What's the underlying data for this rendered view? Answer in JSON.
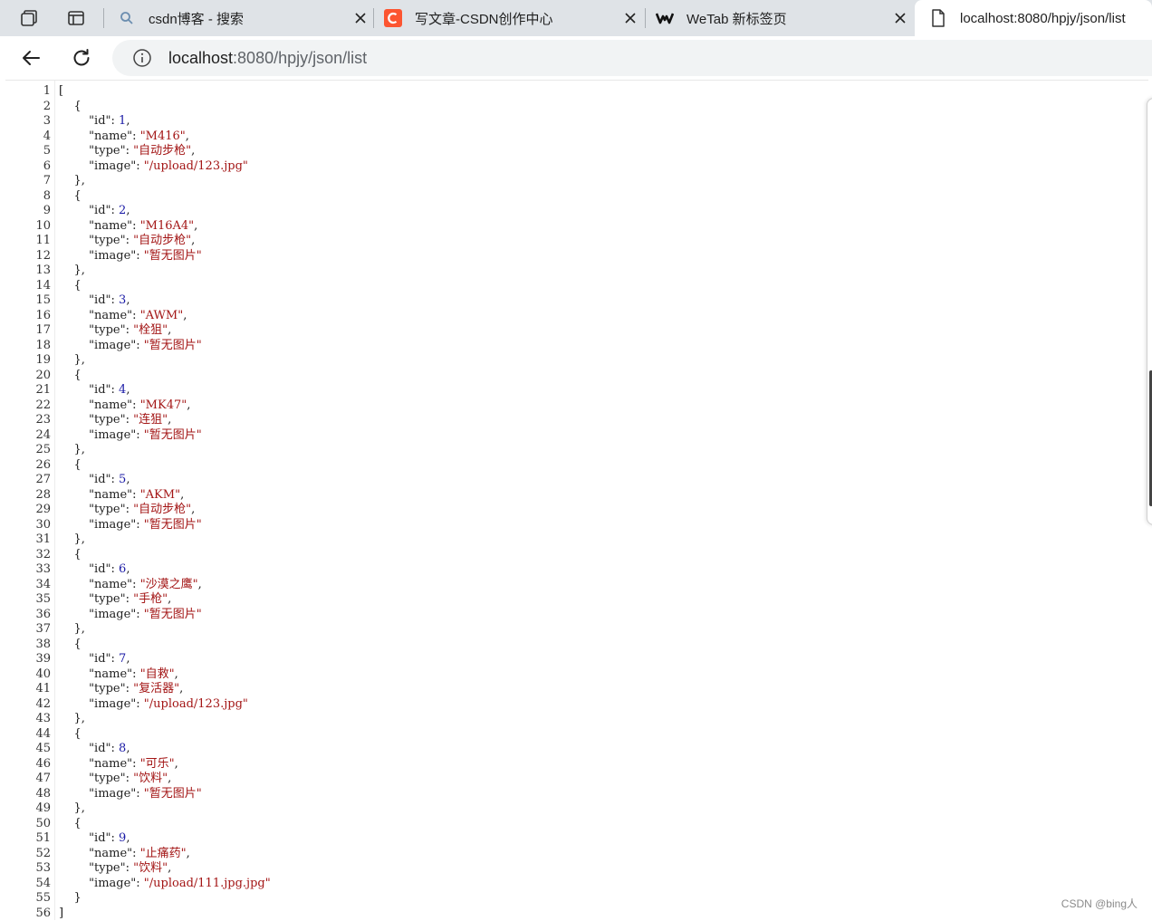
{
  "tabs": [
    {
      "label": "csdn博客 - 搜索",
      "icon": "search-icon"
    },
    {
      "label": "写文章-CSDN创作中心",
      "icon": "csdn-logo-icon"
    },
    {
      "label": "WeTab 新标签页",
      "icon": "wetab-logo-icon"
    },
    {
      "label": "localhost:8080/hpjy/json/list",
      "icon": "page-icon",
      "active": true
    }
  ],
  "address": {
    "host": "localhost",
    "path": ":8080/hpjy/json/list"
  },
  "json_lines": [
    "[",
    "    {",
    "        \"id\": 1,",
    "        \"name\": \"M416\",",
    "        \"type\": \"自动步枪\",",
    "        \"image\": \"/upload/123.jpg\"",
    "    },",
    "    {",
    "        \"id\": 2,",
    "        \"name\": \"M16A4\",",
    "        \"type\": \"自动步枪\",",
    "        \"image\": \"暂无图片\"",
    "    },",
    "    {",
    "        \"id\": 3,",
    "        \"name\": \"AWM\",",
    "        \"type\": \"栓狙\",",
    "        \"image\": \"暂无图片\"",
    "    },",
    "    {",
    "        \"id\": 4,",
    "        \"name\": \"MK47\",",
    "        \"type\": \"连狙\",",
    "        \"image\": \"暂无图片\"",
    "    },",
    "    {",
    "        \"id\": 5,",
    "        \"name\": \"AKM\",",
    "        \"type\": \"自动步枪\",",
    "        \"image\": \"暂无图片\"",
    "    },",
    "    {",
    "        \"id\": 6,",
    "        \"name\": \"沙漠之鹰\",",
    "        \"type\": \"手枪\",",
    "        \"image\": \"暂无图片\"",
    "    },",
    "    {",
    "        \"id\": 7,",
    "        \"name\": \"自救\",",
    "        \"type\": \"复活器\",",
    "        \"image\": \"/upload/123.jpg\"",
    "    },",
    "    {",
    "        \"id\": 8,",
    "        \"name\": \"可乐\",",
    "        \"type\": \"饮料\",",
    "        \"image\": \"暂无图片\"",
    "    },",
    "    {",
    "        \"id\": 9,",
    "        \"name\": \"止痛药\",",
    "        \"type\": \"饮料\",",
    "        \"image\": \"/upload/111.jpg.jpg\"",
    "    }",
    "]"
  ],
  "watermark": "CSDN @bing人",
  "colors": {
    "tabstrip": "#dfe3e7",
    "number": "#1a1aa6",
    "string": "#a31515",
    "csdn_brand": "#fc5531"
  }
}
